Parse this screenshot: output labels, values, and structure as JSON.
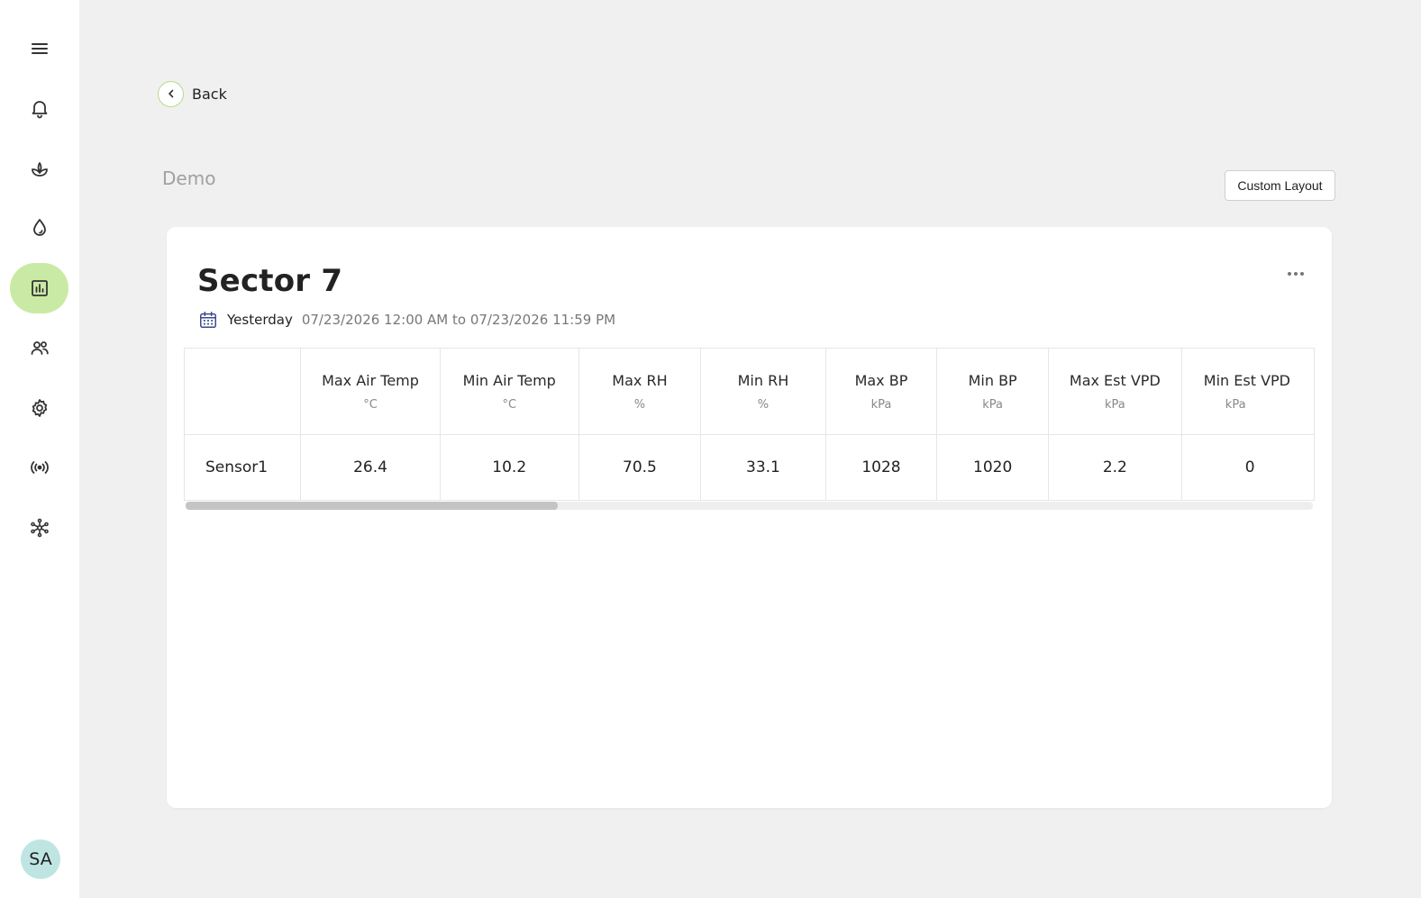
{
  "back": {
    "label": "Back"
  },
  "page": {
    "title": "Demo"
  },
  "toolbar": {
    "custom_layout_label": "Custom Layout"
  },
  "card": {
    "title": "Sector 7",
    "date_preset": "Yesterday",
    "date_range": "07/23/2026 12:00 AM to 07/23/2026 11:59 PM"
  },
  "table": {
    "columns": [
      {
        "label": "Max Air Temp",
        "unit": "°C"
      },
      {
        "label": "Min Air Temp",
        "unit": "°C"
      },
      {
        "label": "Max RH",
        "unit": "%"
      },
      {
        "label": "Min RH",
        "unit": "%"
      },
      {
        "label": "Max BP",
        "unit": "kPa"
      },
      {
        "label": "Min BP",
        "unit": "kPa"
      },
      {
        "label": "Max Est VPD",
        "unit": "kPa"
      },
      {
        "label": "Min Est VPD",
        "unit": "kPa"
      }
    ],
    "rows": [
      {
        "label": "Sensor1",
        "values": [
          "26.4",
          "10.2",
          "70.5",
          "33.1",
          "1028",
          "1020",
          "2.2",
          "0"
        ]
      }
    ]
  },
  "scrollbar": {
    "position_fraction": 0.0,
    "visible_fraction": 0.33
  },
  "user": {
    "initials": "SA"
  },
  "colors": {
    "accent": "#c9eaa5",
    "avatar": "#bfe5e3",
    "background": "#f0f0f0"
  }
}
